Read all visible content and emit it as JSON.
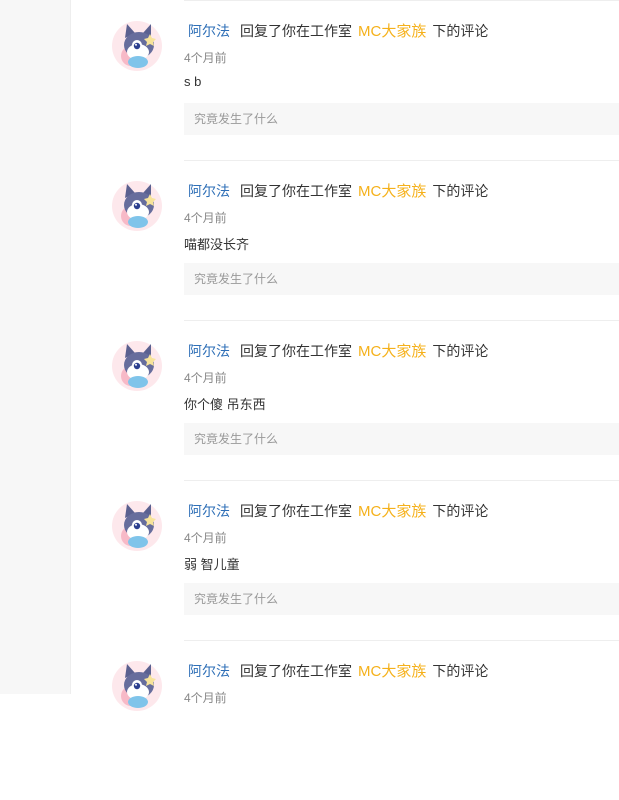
{
  "comments": [
    {
      "user": "阿尔法",
      "action": "回复了你在工作室",
      "topic": "MC大家族",
      "tail": "下的评论",
      "time": "4个月前",
      "content": "s b",
      "quote": "究竟发生了什么"
    },
    {
      "user": "阿尔法",
      "action": "回复了你在工作室",
      "topic": "MC大家族",
      "tail": "下的评论",
      "time": "4个月前",
      "content": "喵都没长齐",
      "quote": "究竟发生了什么"
    },
    {
      "user": "阿尔法",
      "action": "回复了你在工作室",
      "topic": "MC大家族",
      "tail": "下的评论",
      "time": "4个月前",
      "content": "你个傻 吊东西",
      "quote": "究竟发生了什么"
    },
    {
      "user": "阿尔法",
      "action": "回复了你在工作室",
      "topic": "MC大家族",
      "tail": "下的评论",
      "time": "4个月前",
      "content": "弱 智儿童",
      "quote": "究竟发生了什么"
    },
    {
      "user": "阿尔法",
      "action": "回复了你在工作室",
      "topic": "MC大家族",
      "tail": "下的评论",
      "time": "4个月前",
      "content": "",
      "quote": ""
    }
  ],
  "colors": {
    "user": "#2e6fb7",
    "topic": "#f5b11b",
    "quote_bg": "#f7f7f7"
  },
  "icons": {
    "avatar": "cat-avatar-icon"
  }
}
